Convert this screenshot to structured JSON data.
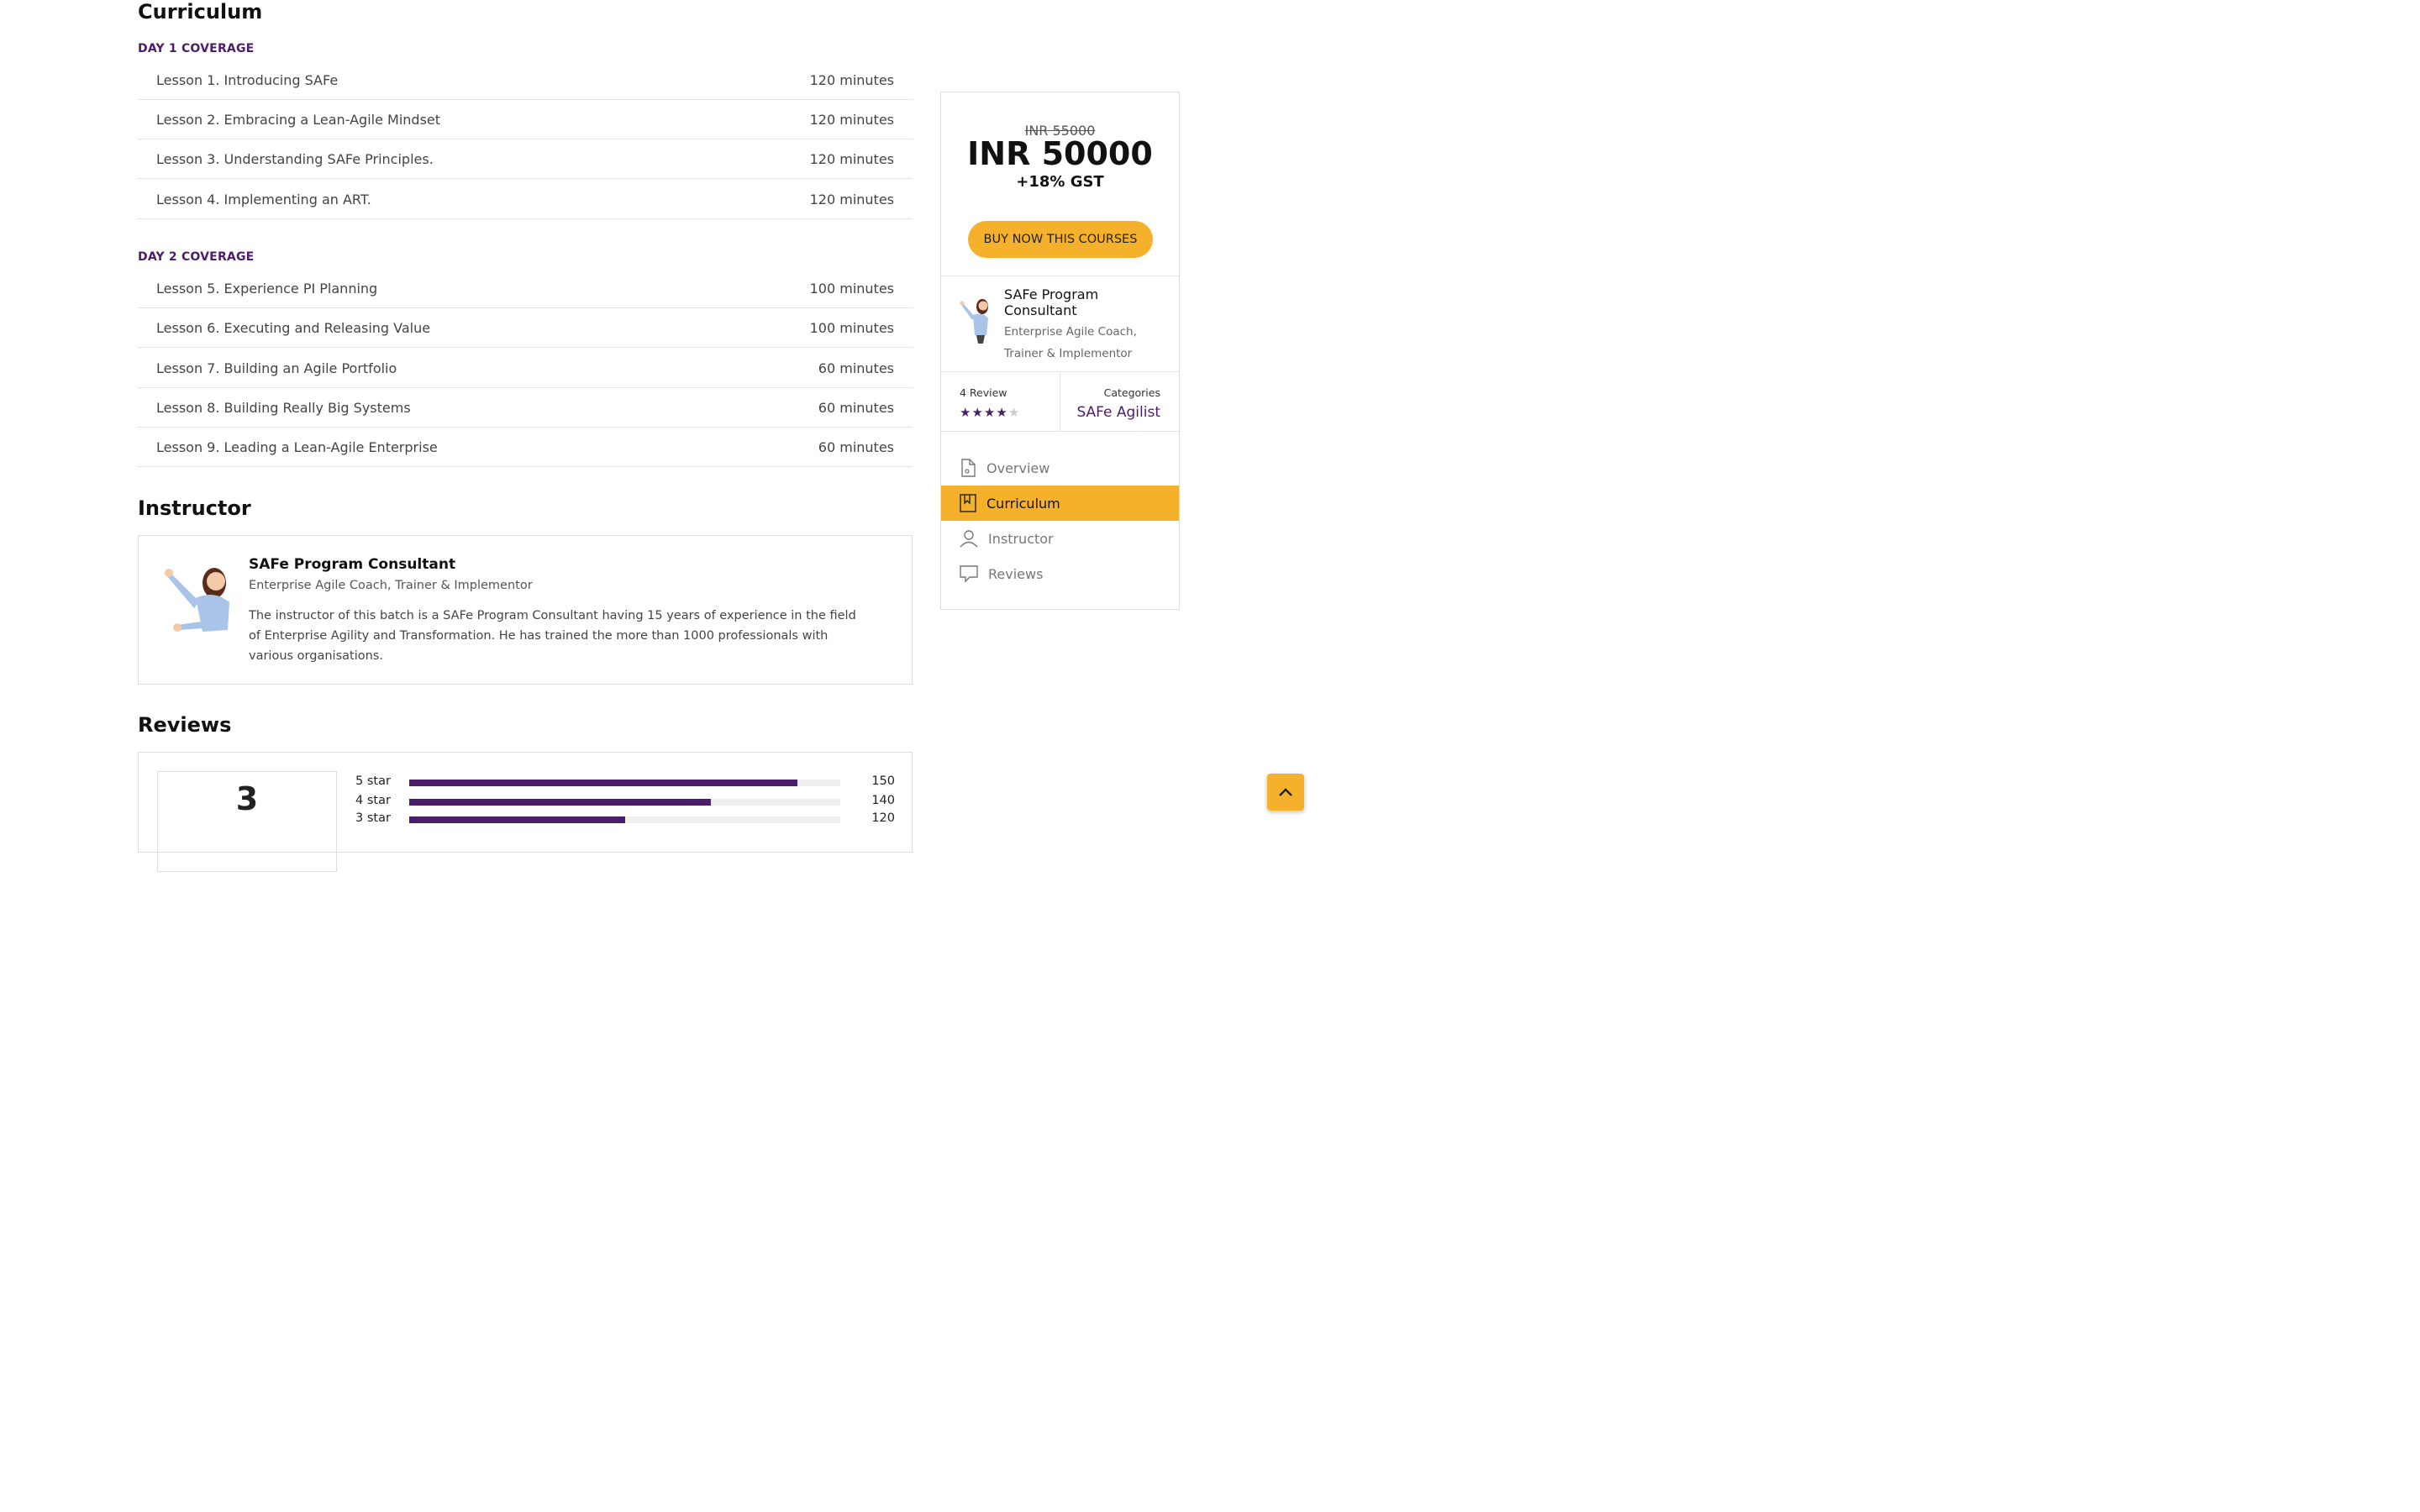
{
  "curriculum": {
    "title": "Curriculum",
    "days": [
      {
        "heading": "DAY 1 COVERAGE",
        "lessons": [
          {
            "title": "Lesson 1. Introducing SAFe",
            "duration": "120 minutes"
          },
          {
            "title": "Lesson 2. Embracing a Lean-Agile Mindset",
            "duration": "120 minutes"
          },
          {
            "title": "Lesson 3. Understanding SAFe Principles.",
            "duration": "120 minutes"
          },
          {
            "title": "Lesson 4. Implementing an ART.",
            "duration": "120 minutes"
          }
        ]
      },
      {
        "heading": "DAY 2 COVERAGE",
        "lessons": [
          {
            "title": "Lesson 5. Experience PI Planning",
            "duration": "100 minutes"
          },
          {
            "title": "Lesson 6. Executing and Releasing Value",
            "duration": "100 minutes"
          },
          {
            "title": "Lesson 7. Building an Agile Portfolio",
            "duration": "60 minutes"
          },
          {
            "title": "Lesson 8. Building Really Big Systems",
            "duration": "60 minutes"
          },
          {
            "title": "Lesson 9. Leading a Lean-Agile Enterprise",
            "duration": "60 minutes"
          }
        ]
      }
    ]
  },
  "instructor": {
    "title": "Instructor",
    "name": "SAFe Program Consultant",
    "subtitle": "Enterprise Agile Coach, Trainer & Implementor",
    "bio": "The instructor of this batch is a SAFe Program Consultant having 15 years of experience in the field of Enterprise Agility and Transformation. He has trained the more than 1000 professionals with various organisations."
  },
  "reviews": {
    "title": "Reviews",
    "average": "3",
    "breakdown": [
      {
        "label": "5 star",
        "count": "150",
        "fraction": 0.9
      },
      {
        "label": "4 star",
        "count": "140",
        "fraction": 0.7
      },
      {
        "label": "3 star",
        "count": "120",
        "fraction": 0.5
      }
    ]
  },
  "sidebar": {
    "old_price": "INR 55000",
    "price": "INR 50000",
    "gst": "+18% GST",
    "buy_label": "BUY NOW THIS COURSES",
    "instructor_name": "SAFe Program Consultant",
    "instructor_sub": "Enterprise Agile Coach, Trainer & Implementor",
    "review_count": "4 Review",
    "rating": 4,
    "rating_max": 5,
    "categories_label": "Categories",
    "category": "SAFe Agilist",
    "nav": [
      {
        "label": "Overview",
        "icon": "document-icon",
        "active": false
      },
      {
        "label": "Curriculum",
        "icon": "bookmark-icon",
        "active": true
      },
      {
        "label": "Instructor",
        "icon": "user-icon",
        "active": false
      },
      {
        "label": "Reviews",
        "icon": "comment-icon",
        "active": false
      }
    ]
  },
  "colors": {
    "accent": "#f5b12c",
    "brand": "#4b1d6b"
  }
}
